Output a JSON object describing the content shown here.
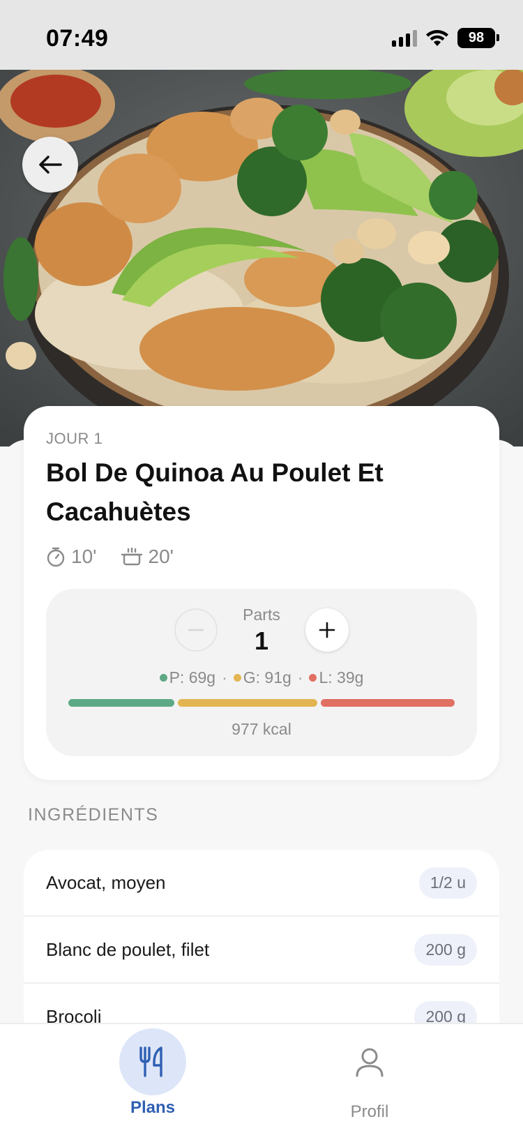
{
  "status_bar": {
    "time": "07:49",
    "battery": "98"
  },
  "hero": {
    "image_icon": "food-photo-icon"
  },
  "navigation": {
    "back_icon": "arrow-left-icon"
  },
  "recipe": {
    "day": "JOUR 1",
    "title": "Bol De Quinoa Au Poulet Et Cacahuètes",
    "prep_time": "10'",
    "cook_time": "20'"
  },
  "portions": {
    "label": "Parts",
    "value": "1",
    "minus_icon": "minus-icon",
    "plus_icon": "plus-icon"
  },
  "macros": {
    "protein": "P: 69g",
    "carbs": "G: 91g",
    "fat": "L: 39g",
    "separator": "·",
    "kcal": "977 kcal",
    "colors": {
      "protein": "#5ea985",
      "carbs": "#e3b552",
      "fat": "#e07062"
    }
  },
  "ingredients": {
    "section_title": "INGRÉDIENTS",
    "items": [
      {
        "name": "Avocat, moyen",
        "quantity": "1/2 u"
      },
      {
        "name": "Blanc de poulet, filet",
        "quantity": "200 g"
      },
      {
        "name": "Brocoli",
        "quantity": "200 g"
      }
    ]
  },
  "tab_bar": {
    "plans": {
      "label": "Plans",
      "icon": "utensils-icon"
    },
    "profile": {
      "label": "Profil",
      "icon": "user-icon"
    }
  }
}
